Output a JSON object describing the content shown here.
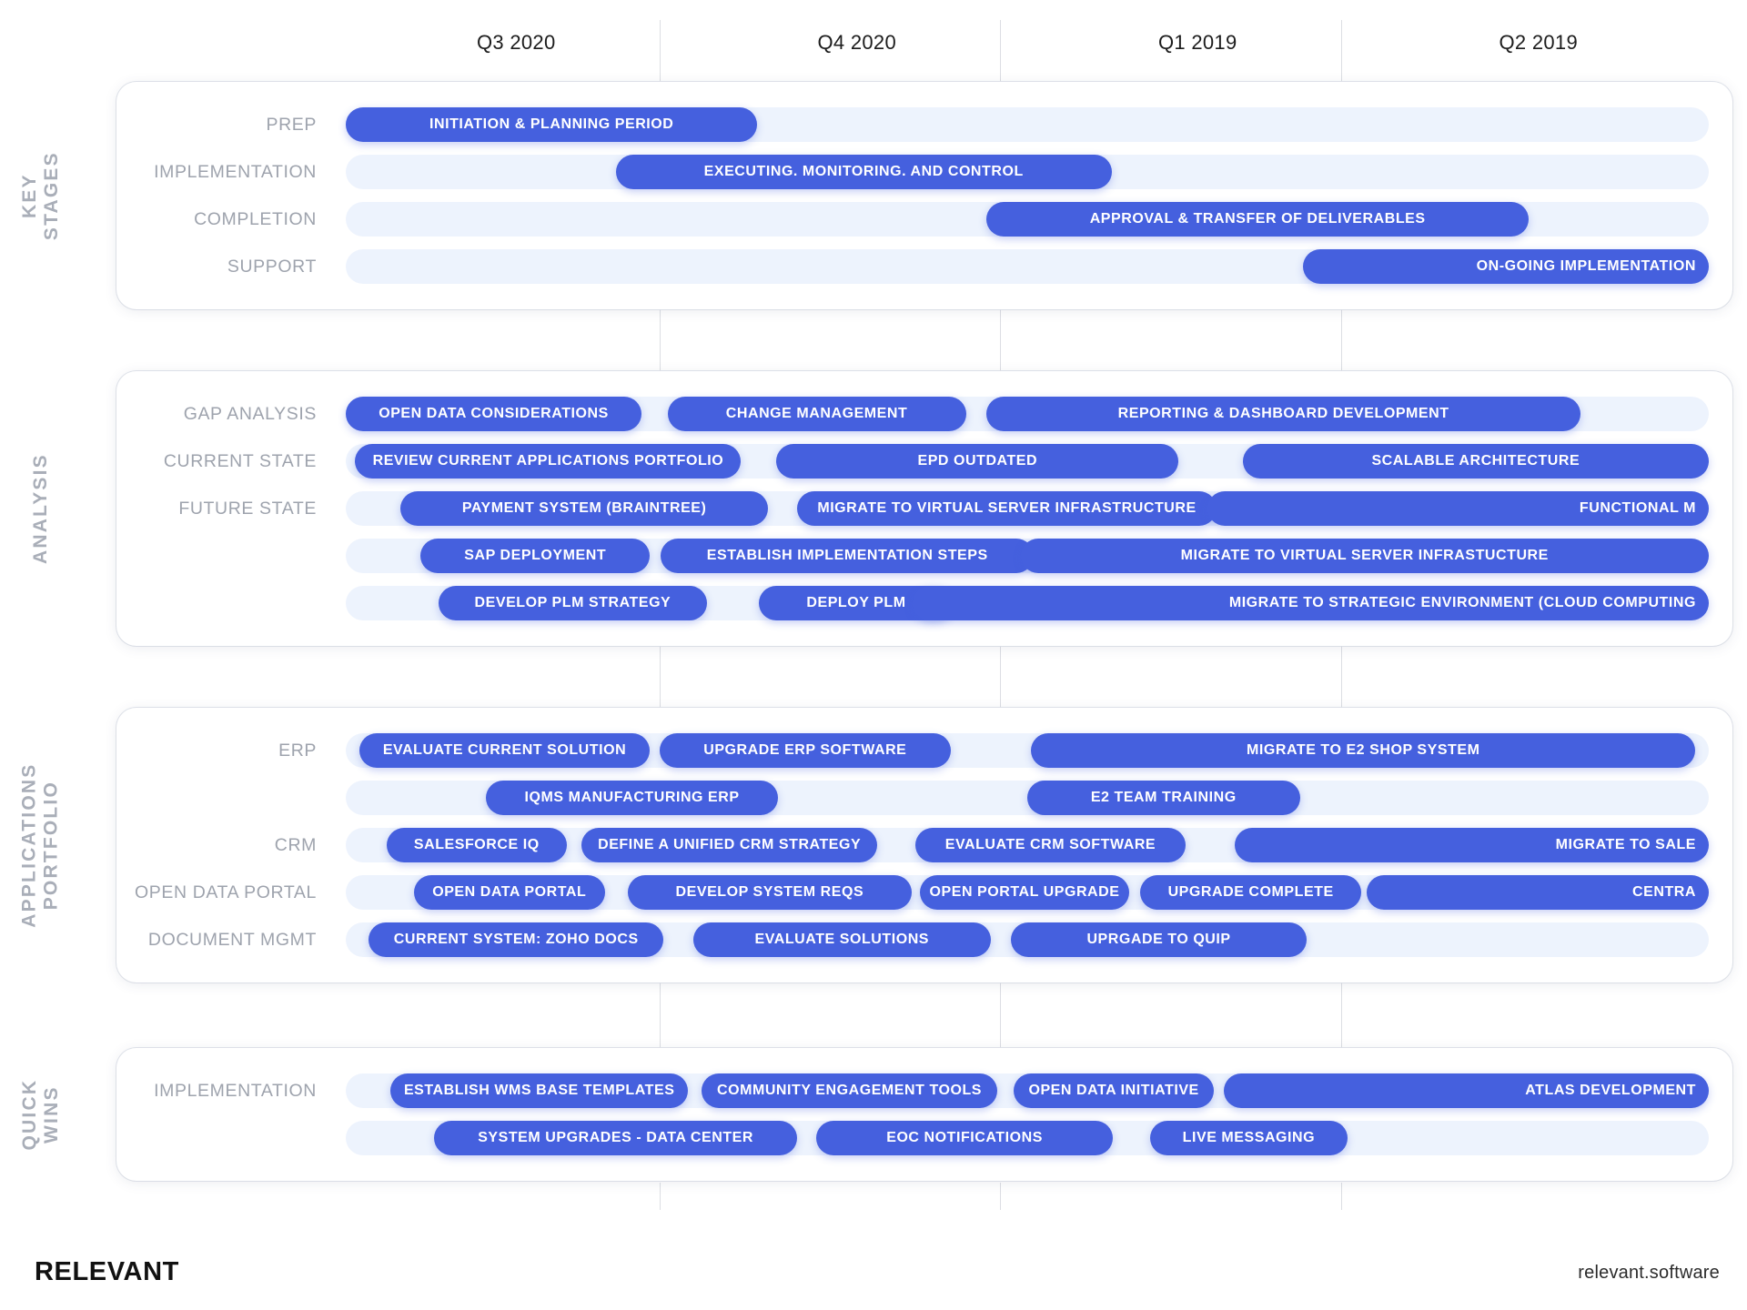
{
  "colors": {
    "bar_fill": "#4560de",
    "track_fill": "#edf3fd",
    "row_label": "#9ea3ad",
    "section_title": "#a9aeb8",
    "grid_line": "#dcdee3",
    "card_bg": "#ffffff"
  },
  "timeline": {
    "quarters": [
      {
        "label": "Q3 2020"
      },
      {
        "label": "Q4 2020"
      },
      {
        "label": "Q1 2019"
      },
      {
        "label": "Q2 2019"
      }
    ]
  },
  "footer": {
    "logo": "RELEVANT",
    "url": "relevant.software"
  },
  "chart_data": {
    "type": "bar",
    "title": "Project Roadmap / Gantt Timeline",
    "categories": [
      "Q3 2020",
      "Q4 2020",
      "Q1 2019",
      "Q2 2019"
    ],
    "xlabel": "",
    "ylabel": "",
    "grid": true,
    "legend": "none",
    "sections": [
      {
        "title": "KEY STAGES",
        "rows": [
          {
            "label": "PREP",
            "bars": [
              {
                "text": "INITIATION & PLANNING PERIOD",
                "start_pct": 0.0,
                "end_pct": 30.2
              }
            ]
          },
          {
            "label": "IMPLEMENTATION",
            "bars": [
              {
                "text": "EXECUTING. MONITORING. AND CONTROL",
                "start_pct": 19.8,
                "end_pct": 56.2
              }
            ]
          },
          {
            "label": "COMPLETION",
            "bars": [
              {
                "text": "APPROVAL & TRANSFER OF DELIVERABLES",
                "start_pct": 47.0,
                "end_pct": 86.8
              }
            ]
          },
          {
            "label": "SUPPORT",
            "bars": [
              {
                "text": "ON-GOING IMPLEMENTATION",
                "start_pct": 70.2,
                "end_pct": 100.0,
                "align": "right"
              }
            ]
          }
        ]
      },
      {
        "title": "ANALYSIS",
        "rows": [
          {
            "label": "GAP ANALYSIS",
            "bars": [
              {
                "text": "OPEN DATA CONSIDERATIONS",
                "start_pct": 0.0,
                "end_pct": 21.7
              },
              {
                "text": "CHANGE MANAGEMENT",
                "start_pct": 23.6,
                "end_pct": 45.5
              },
              {
                "text": "REPORTING & DASHBOARD DEVELOPMENT",
                "start_pct": 47.0,
                "end_pct": 90.6
              }
            ]
          },
          {
            "label": "CURRENT STATE",
            "bars": [
              {
                "text": "REVIEW CURRENT APPLICATIONS PORTFOLIO",
                "start_pct": 0.7,
                "end_pct": 29.0
              },
              {
                "text": "EPD OUTDATED",
                "start_pct": 31.6,
                "end_pct": 61.1
              },
              {
                "text": "SCALABLE ARCHITECTURE",
                "start_pct": 65.8,
                "end_pct": 100.0
              }
            ]
          },
          {
            "label": "FUTURE STATE",
            "bars": [
              {
                "text": "PAYMENT SYSTEM (BRAINTREE)",
                "start_pct": 4.0,
                "end_pct": 31.0
              },
              {
                "text": "MIGRATE TO VIRTUAL SERVER INFRASTRUCTURE",
                "start_pct": 33.1,
                "end_pct": 63.9
              },
              {
                "text": "FUNCTIONAL M",
                "start_pct": 63.2,
                "end_pct": 100.0,
                "align": "right"
              }
            ]
          },
          {
            "label": "",
            "bars": [
              {
                "text": "SAP DEPLOYMENT",
                "start_pct": 5.5,
                "end_pct": 22.3
              },
              {
                "text": "ESTABLISH IMPLEMENTATION STEPS",
                "start_pct": 23.1,
                "end_pct": 50.5
              },
              {
                "text": "MIGRATE TO VIRTUAL SERVER INFRASTUCTURE",
                "start_pct": 49.5,
                "end_pct": 100.0
              }
            ]
          },
          {
            "label": "",
            "bars": [
              {
                "text": "DEVELOP PLM STRATEGY",
                "start_pct": 6.8,
                "end_pct": 26.5
              },
              {
                "text": "DEPLOY PLM",
                "start_pct": 30.3,
                "end_pct": 44.6
              },
              {
                "text": "MIGRATE TO STRATEGIC ENVIRONMENT (CLOUD COMPUTING",
                "start_pct": 41.6,
                "end_pct": 100.0,
                "align": "right"
              }
            ]
          }
        ]
      },
      {
        "title": "APPLICATIONS PORTFOLIO",
        "rows": [
          {
            "label": "ERP",
            "bars": [
              {
                "text": "EVALUATE CURRENT SOLUTION",
                "start_pct": 1.0,
                "end_pct": 22.3
              },
              {
                "text": "UPGRADE ERP SOFTWARE",
                "start_pct": 23.0,
                "end_pct": 44.4
              },
              {
                "text": "MIGRATE TO E2 SHOP SYSTEM",
                "start_pct": 50.3,
                "end_pct": 99.0
              }
            ]
          },
          {
            "label": "",
            "bars": [
              {
                "text": "IQMS MANUFACTURING ERP",
                "start_pct": 10.3,
                "end_pct": 31.7
              },
              {
                "text": "E2 TEAM TRAINING",
                "start_pct": 50.0,
                "end_pct": 70.0
              }
            ]
          },
          {
            "label": "CRM",
            "bars": [
              {
                "text": "SALESFORCE IQ",
                "start_pct": 3.0,
                "end_pct": 16.2
              },
              {
                "text": "DEFINE A UNIFIED CRM STRATEGY",
                "start_pct": 17.3,
                "end_pct": 39.0
              },
              {
                "text": "EVALUATE CRM SOFTWARE",
                "start_pct": 41.8,
                "end_pct": 61.6
              },
              {
                "text": "MIGRATE TO SALE",
                "start_pct": 65.2,
                "end_pct": 100.0,
                "align": "right"
              }
            ]
          },
          {
            "label": "OPEN DATA PORTAL",
            "bars": [
              {
                "text": "OPEN DATA PORTAL",
                "start_pct": 5.0,
                "end_pct": 19.0
              },
              {
                "text": "DEVELOP SYSTEM REQS",
                "start_pct": 20.7,
                "end_pct": 41.5
              },
              {
                "text": "OPEN PORTAL UPGRADE",
                "start_pct": 42.1,
                "end_pct": 57.5
              },
              {
                "text": "UPGRADE COMPLETE",
                "start_pct": 58.3,
                "end_pct": 74.5
              },
              {
                "text": "CENTRA",
                "start_pct": 74.9,
                "end_pct": 100.0,
                "align": "right"
              }
            ]
          },
          {
            "label": "DOCUMENT MGMT",
            "bars": [
              {
                "text": "CURRENT SYSTEM: ZOHO DOCS",
                "start_pct": 1.7,
                "end_pct": 23.3
              },
              {
                "text": "EVALUATE SOLUTIONS",
                "start_pct": 25.5,
                "end_pct": 47.3
              },
              {
                "text": "UPRGADE TO QUIP",
                "start_pct": 48.8,
                "end_pct": 70.5
              }
            ]
          }
        ]
      },
      {
        "title": "QUICK WINS",
        "rows": [
          {
            "label": "IMPLEMENTATION",
            "bars": [
              {
                "text": "ESTABLISH WMS BASE TEMPLATES",
                "start_pct": 3.3,
                "end_pct": 25.1
              },
              {
                "text": "COMMUNITY ENGAGEMENT TOOLS",
                "start_pct": 26.1,
                "end_pct": 47.8
              },
              {
                "text": "OPEN DATA INITIATIVE",
                "start_pct": 49.0,
                "end_pct": 63.7
              },
              {
                "text": "ATLAS DEVELOPMENT",
                "start_pct": 64.4,
                "end_pct": 100.0,
                "align": "right"
              }
            ]
          },
          {
            "label": "",
            "bars": [
              {
                "text": "SYSTEM UPGRADES - DATA CENTER",
                "start_pct": 6.5,
                "end_pct": 33.1
              },
              {
                "text": "EOC NOTIFICATIONS",
                "start_pct": 34.5,
                "end_pct": 56.3
              },
              {
                "text": "LIVE MESSAGING",
                "start_pct": 59.0,
                "end_pct": 73.5
              }
            ]
          }
        ]
      }
    ]
  }
}
